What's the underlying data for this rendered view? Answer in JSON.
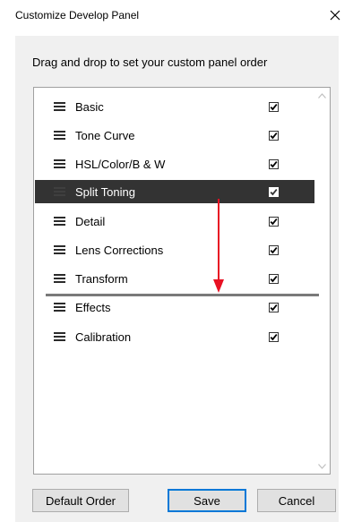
{
  "dialog": {
    "title": "Customize Develop Panel",
    "instruction": "Drag and drop to set your custom panel order"
  },
  "panels": [
    {
      "label": "Basic",
      "checked": true,
      "selected": false
    },
    {
      "label": "Tone Curve",
      "checked": true,
      "selected": false
    },
    {
      "label": "HSL/Color/B & W",
      "checked": true,
      "selected": false
    },
    {
      "label": "Split Toning",
      "checked": true,
      "selected": true
    },
    {
      "label": "Detail",
      "checked": true,
      "selected": false
    },
    {
      "label": "Lens Corrections",
      "checked": true,
      "selected": false
    },
    {
      "label": "Transform",
      "checked": true,
      "selected": false
    },
    {
      "label": "Effects",
      "checked": true,
      "selected": false
    },
    {
      "label": "Calibration",
      "checked": true,
      "selected": false
    }
  ],
  "buttons": {
    "default_order": "Default Order",
    "save": "Save",
    "cancel": "Cancel"
  },
  "colors": {
    "selection": "#333333",
    "drag_arrow": "#e81123",
    "focus_border": "#0078d7"
  },
  "icons": {
    "close": "close-icon",
    "drag_handle": "hamburger-icon",
    "checkbox": "checkbox-checked-icon",
    "drag_direction": "arrow-down-icon"
  }
}
